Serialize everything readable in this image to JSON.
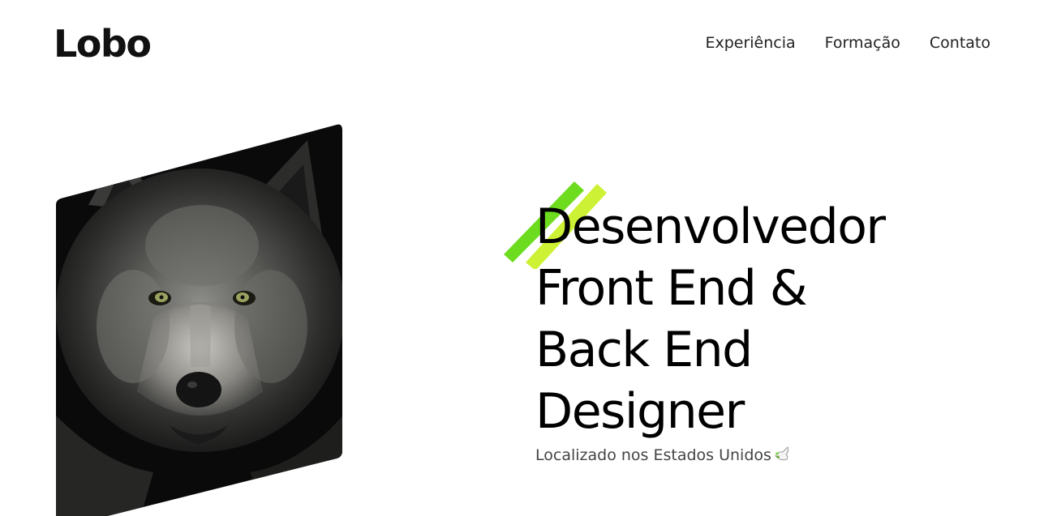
{
  "header": {
    "logo": "Lobo",
    "nav": [
      {
        "label": "Experiência"
      },
      {
        "label": "Formação"
      },
      {
        "label": "Contato"
      }
    ]
  },
  "hero": {
    "image_icon": "wolf-portrait",
    "headline_lines": [
      "Desenvolvedor",
      "Front End &",
      "Back End",
      "Designer"
    ],
    "location": "Localizado nos Estados Unidos",
    "location_icon": "dove-icon",
    "accent_colors": [
      "#6ddc1f",
      "#cdf235"
    ]
  }
}
